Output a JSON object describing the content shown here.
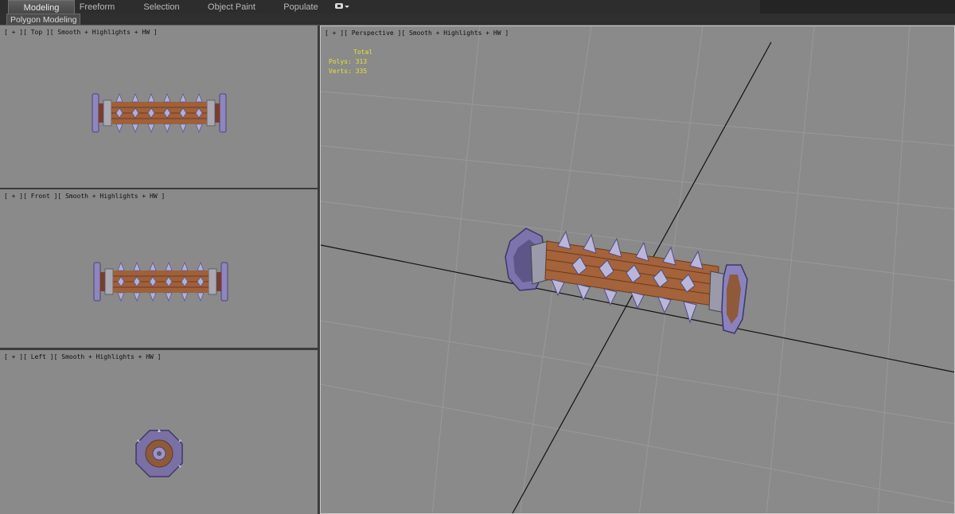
{
  "ribbon": {
    "tabs": [
      {
        "label": "Modeling",
        "active": true
      },
      {
        "label": "Freeform",
        "active": false
      },
      {
        "label": "Selection",
        "active": false
      },
      {
        "label": "Object Paint",
        "active": false
      },
      {
        "label": "Populate",
        "active": false
      }
    ],
    "panel_label": "Polygon Modeling"
  },
  "viewports": {
    "top": {
      "label": "[ + ][ Top ][ Smooth + Highlights + HW ]"
    },
    "front": {
      "label": "[ + ][ Front ][ Smooth + Highlights + HW ]"
    },
    "left": {
      "label": "[ + ][ Left ][ Smooth + Highlights + HW ]"
    },
    "perspective": {
      "label": "[ + ][ Perspective ][ Smooth + Highlights + HW ]",
      "stats": {
        "header": "Total",
        "polys": "Polys: 313",
        "verts": "Verts: 335"
      }
    }
  },
  "colors": {
    "viewport_bg": "#8a8a8a",
    "grid_line": "#9b9b9b",
    "stats_text": "#e8e030",
    "wood": "#9c5a2e",
    "metal": "#7d74a8"
  }
}
